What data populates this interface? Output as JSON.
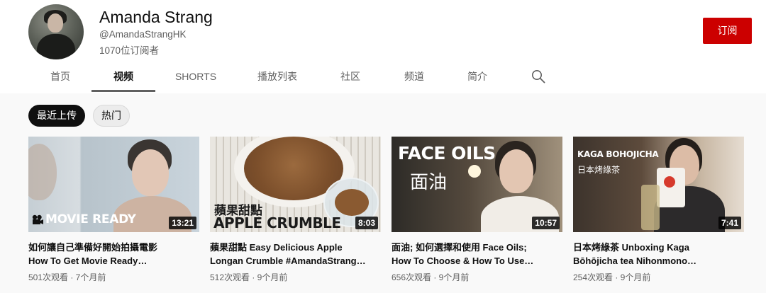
{
  "channel": {
    "name": "Amanda Strang",
    "handle": "@AmandaStrangHK",
    "subscribers": "1070位订阅者",
    "subscribe_label": "订阅"
  },
  "tabs": [
    {
      "label": "首页"
    },
    {
      "label": "视频",
      "active": true
    },
    {
      "label": "SHORTS"
    },
    {
      "label": "播放列表"
    },
    {
      "label": "社区"
    },
    {
      "label": "频道"
    },
    {
      "label": "简介"
    }
  ],
  "filters": [
    {
      "label": "最近上传",
      "selected": true
    },
    {
      "label": "热门",
      "selected": false
    }
  ],
  "videos": [
    {
      "title_line1": "如何讓自己準備好開始拍攝電影",
      "title_line2": "How To Get Movie Ready…",
      "meta": "501次观看 · 7个月前",
      "duration": "13:21",
      "thumb_text": "MOVIE READY"
    },
    {
      "title_line1": "蘋果甜點 Easy Delicious Apple",
      "title_line2": "Longan Crumble #AmandaStrang…",
      "meta": "512次观看 · 9个月前",
      "duration": "8:03",
      "thumb_text_cn": "蘋果甜點",
      "thumb_text": "APPLE CRUMBLE"
    },
    {
      "title_line1": "面油; 如何選擇和使用 Face Oils;",
      "title_line2": "How To Choose & How To Use…",
      "meta": "656次观看 · 9个月前",
      "duration": "10:57",
      "thumb_text": "FACE OILS",
      "thumb_text_cn": "面油"
    },
    {
      "title_line1": "日本烤綠茶 Unboxing Kaga",
      "title_line2": "Bōhōjicha tea Nihonmono…",
      "meta": "254次观看 · 9个月前",
      "duration": "7:41",
      "thumb_text": "KAGA BOHOJICHA",
      "thumb_text_cn": "日本烤綠茶"
    }
  ],
  "colors": {
    "subscribe": "#cc0000",
    "chip_selected": "#0f0f0f",
    "content_bg": "#f9f9f9"
  },
  "icons": {
    "search": "search-icon",
    "camera": "movie-camera-icon"
  }
}
